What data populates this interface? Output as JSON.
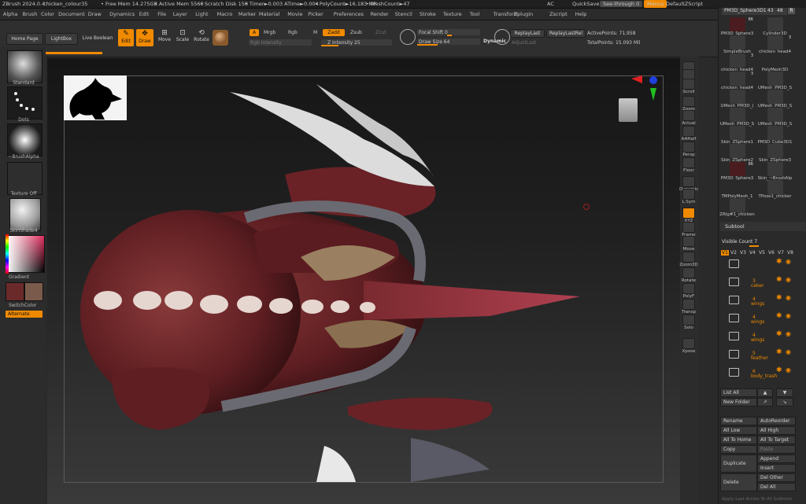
{
  "titlebar": {
    "app": "ZBrush 2024.0.4",
    "project": "chicken_colour35",
    "free_mem": "• Free Mem 14.275GB",
    "active_mem": "• Active Mem 5560",
    "scratch": "• Scratch Disk 150",
    "timer": "• Timer►0.003 ATime►0.004",
    "polycount": "• PolyCount►16.183 MP",
    "meshcount": "• MeshCount►47",
    "ac": "AC",
    "quicksave": "QuickSave",
    "see_through": "See-through  0",
    "menus": "Menus",
    "script": "DefaultZScript"
  },
  "menubar": [
    "Alpha",
    "Brush",
    "Color",
    "Document",
    "Draw",
    "Dynamics",
    "Edit",
    "File",
    "Layer",
    "Light",
    "Macro",
    "Marker",
    "Material",
    "Movie",
    "Picker",
    "Preferences",
    "Render",
    "Stencil",
    "Stroke",
    "Texture",
    "Tool",
    "Transform",
    "Zplugin",
    "Zscript",
    "Help"
  ],
  "toolbar": {
    "home": "Home Page",
    "lightbox": "LightBox",
    "live_boolean": "Live Boolean",
    "edit": "Edit",
    "draw": "Draw",
    "move": "Move",
    "scale": "Scale",
    "rotate": "Rotate",
    "a": "A",
    "mrgb": "Mrgb",
    "rgb": "Rgb",
    "m": "M",
    "zadd": "Zadd",
    "zsub": "Zsub",
    "zcut": "Zcut",
    "rgb_intensity": "Rgb Intensity",
    "z_intensity": "Z Intensity 25",
    "focal_shift": "Focal Shift 0",
    "draw_size": "Draw Size 64",
    "dynamic": "Dynamic",
    "replaylast": "ReplayLast",
    "replaylastrel": "ReplayLastRel",
    "adjustlast": "AdjustLast",
    "active_points": "ActivePoints: 71,958",
    "total_points": "TotalPoints: 15.093 Mil"
  },
  "leftshelf": {
    "standard": "Standard",
    "dots": "Dots",
    "brushalpha": "~BrushAlpha",
    "texture_off": "Texture Off",
    "skinshade": "SkinShade4",
    "gradient": "Gradient",
    "switchcolor": "SwitchColor",
    "alternate": "Alternate",
    "main_color": "#6b2a2a",
    "secondary_color": "#7a5a4a"
  },
  "rightshelf": [
    {
      "name": "bpr",
      "label": "BPR"
    },
    {
      "name": "spix",
      "label": "SPix 3"
    },
    {
      "name": "scroll",
      "label": "Scroll"
    },
    {
      "name": "zoom",
      "label": "Zoom"
    },
    {
      "name": "actual",
      "label": "Actual"
    },
    {
      "name": "aahalf",
      "label": "AAHalf"
    },
    {
      "name": "persp",
      "label": "Persp"
    },
    {
      "name": "floor",
      "label": "Floor"
    },
    {
      "name": "dynamic",
      "label": "Dynamic"
    },
    {
      "name": "lsym",
      "label": "L.Sym"
    },
    {
      "name": "xyz",
      "label": "XYZ"
    },
    {
      "name": "frame",
      "label": "Frame"
    },
    {
      "name": "move",
      "label": "Move"
    },
    {
      "name": "zoom3d",
      "label": "Zoom3D"
    },
    {
      "name": "rotate",
      "label": "Rotate"
    },
    {
      "name": "polyf",
      "label": "PolyF"
    },
    {
      "name": "transp",
      "label": "Transp"
    },
    {
      "name": "solo",
      "label": "Solo"
    },
    {
      "name": "xpose",
      "label": "Xpose"
    }
  ],
  "tools": {
    "header": "PM3D_Sphere3D1",
    "header_num1": "43",
    "header_num2": "48",
    "items": [
      {
        "label": "PM3D_Sphere3",
        "count": "86"
      },
      {
        "label": "Cylinder3D",
        "count": ""
      },
      {
        "label": "SimpleBrush",
        "count": ""
      },
      {
        "label": "chicken_head4",
        "count": "3"
      },
      {
        "label": "chicken_head4",
        "count": "3"
      },
      {
        "label": "PolyMesh3D",
        "count": ""
      },
      {
        "label": "chicken_head4",
        "count": "3"
      },
      {
        "label": "UMesh_PM3D_S",
        "count": ""
      },
      {
        "label": "UMesh_PM3D_(",
        "count": ""
      },
      {
        "label": "UMesh_PM3D_S",
        "count": ""
      },
      {
        "label": "UMesh_PM3D_S",
        "count": ""
      },
      {
        "label": "UMesh_PM3D_S",
        "count": ""
      },
      {
        "label": "Skin_ZSphere1",
        "count": ""
      },
      {
        "label": "PM3D_Cube3D1",
        "count": ""
      },
      {
        "label": "Skin_ZSphere2",
        "count": ""
      },
      {
        "label": "Skin_ZSphere3",
        "count": ""
      },
      {
        "label": "PM3D_Sphere3",
        "count": "86"
      },
      {
        "label": "Skin_~BrushAlp",
        "count": ""
      },
      {
        "label": "TMPolyMesh_1",
        "count": ""
      },
      {
        "label": "TPose1_chicker",
        "count": ""
      },
      {
        "label": "ZRig#1_chicken",
        "count": ""
      }
    ]
  },
  "subtool": {
    "title": "Subtool",
    "visible_count": "Visible Count 7",
    "tabs": [
      "V1",
      "V2",
      "V3",
      "V4",
      "V5",
      "V6",
      "V7",
      "V8"
    ],
    "items": [
      {
        "index": "",
        "name": ""
      },
      {
        "index": "3",
        "name": "ceker"
      },
      {
        "index": "4",
        "name": "wings"
      },
      {
        "index": "4",
        "name": "wings"
      },
      {
        "index": "4",
        "name": "wings"
      },
      {
        "index": "5",
        "name": "feather"
      },
      {
        "index": "6",
        "name": "body_trash"
      }
    ],
    "list_all": "List All",
    "new_folder": "New Folder",
    "rename": "Rename",
    "autoreorder": "AutoReorder",
    "all_low": "All Low",
    "all_high": "All High",
    "all_to_home": "All To Home",
    "all_to_target": "All To Target",
    "copy": "Copy",
    "paste": "Paste",
    "duplicate": "Duplicate",
    "append": "Append",
    "insert": "Insert",
    "delete": "Delete",
    "del_other": "Del Other",
    "del_all": "Del All",
    "apply_last": "Apply Last Action To All Subtools"
  },
  "accent": "#f08a00"
}
